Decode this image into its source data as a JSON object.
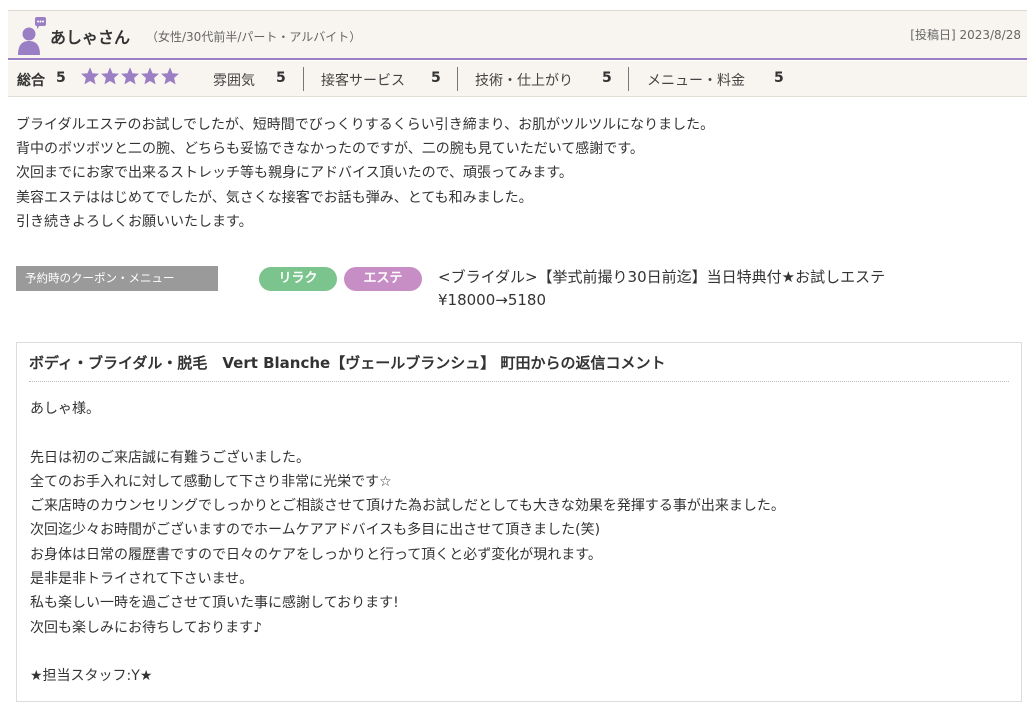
{
  "reviewer": {
    "name": "あしゃさん",
    "meta": "（女性/30代前半/パート・アルバイト）",
    "post_date": "[投稿日] 2023/8/28"
  },
  "ratings": {
    "total_label": "総合",
    "total_value": "5",
    "stars": 5,
    "star_color": "#9b7fc4",
    "items": [
      {
        "label": "雰囲気",
        "value": "5"
      },
      {
        "label": "接客サービス",
        "value": "5"
      },
      {
        "label": "技術・仕上がり",
        "value": "5"
      },
      {
        "label": "メニュー・料金",
        "value": "5"
      }
    ]
  },
  "review": {
    "lines": [
      "ブライダルエステのお試しでしたが、短時間でびっくりするくらい引き締まり、お肌がツルツルになりました。",
      "背中のボツボツと二の腕、どちらも妥協できなかったのですが、二の腕も見ていただいて感謝です。",
      "次回までにお家で出来るストレッチ等も親身にアドバイス頂いたので、頑張ってみます。",
      "美容エステははじめてでしたが、気さくな接客でお話も弾み、とても和みました。",
      "引き続きよろしくお願いいたします。"
    ]
  },
  "coupon": {
    "label": "予約時のクーポン・メニュー",
    "tags": [
      "リラク",
      "エステ"
    ],
    "tag_colors": [
      "#7cc48d",
      "#c78dc5"
    ],
    "menu_name": "<ブライダル>【挙式前撮り30日前迄】当日特典付★お試しエステ",
    "price": "¥18000→5180"
  },
  "reply": {
    "title": "ボディ・ブライダル・脱毛　Vert Blanche【ヴェールブランシュ】 町田からの返信コメント",
    "lines": [
      "あしゃ様。",
      "",
      "先日は初のご来店誠に有難うございました。",
      "全てのお手入れに対して感動して下さり非常に光栄です☆",
      "ご来店時のカウンセリングでしっかりとご相談させて頂けた為お試しだとしても大きな効果を発揮する事が出来ました。",
      "次回迄少々お時間がございますのでホームケアアドバイスも多目に出させて頂きました(笑)",
      "お身体は日常の履歴書ですので日々のケアをしっかりと行って頂くと必ず変化が現れます。",
      "是非是非トライされて下さいませ。",
      "私も楽しい一時を過ごさせて頂いた事に感謝しております!",
      "次回も楽しみにお待ちしております♪",
      "",
      "★担当スタッフ:Y★"
    ]
  }
}
